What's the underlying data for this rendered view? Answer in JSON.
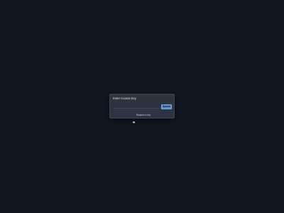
{
  "dialog": {
    "title": "Enter Access Key",
    "input": {
      "value": "",
      "placeholder": ""
    },
    "submit_label": "Submit",
    "request_link": {
      "icon": "mail-icon",
      "label": "Request a key"
    }
  },
  "colors": {
    "background": "#101720",
    "dialog_background": "#2b3440",
    "accent": "#5b8fc7"
  }
}
